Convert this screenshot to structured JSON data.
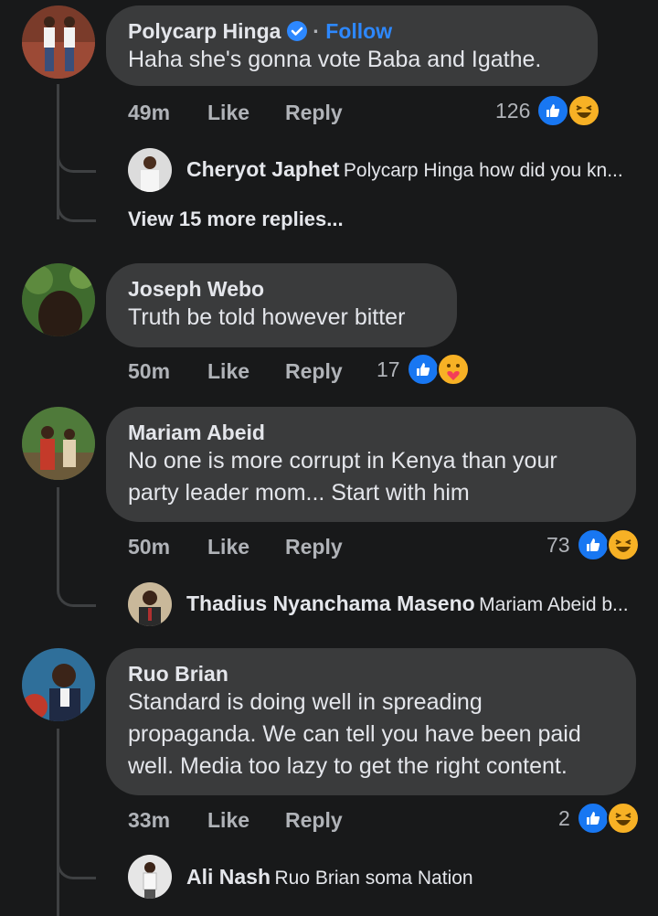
{
  "comments": [
    {
      "author": "Polycarp Hinga",
      "verified": true,
      "follow_label": "Follow",
      "text_lines": [
        "Haha she's gonna vote Baba and Igathe."
      ],
      "time": "49m",
      "like_label": "Like",
      "reply_label": "Reply",
      "reaction_count": "126",
      "reactions": [
        "like",
        "haha"
      ],
      "reply_preview": {
        "author": "Cheryot Japhet",
        "text": "Polycarp Hinga how did you kn..."
      },
      "view_more": "View 15 more replies..."
    },
    {
      "author": "Joseph Webo",
      "text_lines": [
        "Truth be told however bitter"
      ],
      "time": "50m",
      "like_label": "Like",
      "reply_label": "Reply",
      "reaction_count": "17",
      "reactions": [
        "like",
        "care"
      ]
    },
    {
      "author": "Mariam Abeid",
      "text_lines": [
        "No one is more corrupt in Kenya than your",
        "party leader mom... Start with him"
      ],
      "time": "50m",
      "like_label": "Like",
      "reply_label": "Reply",
      "reaction_count": "73",
      "reactions": [
        "like",
        "haha"
      ],
      "reply_preview": {
        "author": "Thadius Nyanchama Maseno",
        "text": "Mariam Abeid b..."
      }
    },
    {
      "author": "Ruo Brian",
      "text_lines": [
        "Standard is doing well in spreading",
        "propaganda. We can tell you have been paid",
        "well. Media too lazy to get the right content."
      ],
      "time": "33m",
      "like_label": "Like",
      "reply_label": "Reply",
      "reaction_count": "2",
      "reactions": [
        "like",
        "haha"
      ],
      "reply_preview": {
        "author": "Ali Nash",
        "text": "Ruo Brian soma Nation"
      }
    }
  ],
  "colors": {
    "background": "#18191a",
    "bubble": "#3a3b3c",
    "accent": "#2d88ff",
    "secondary_text": "#b0b3b8"
  }
}
